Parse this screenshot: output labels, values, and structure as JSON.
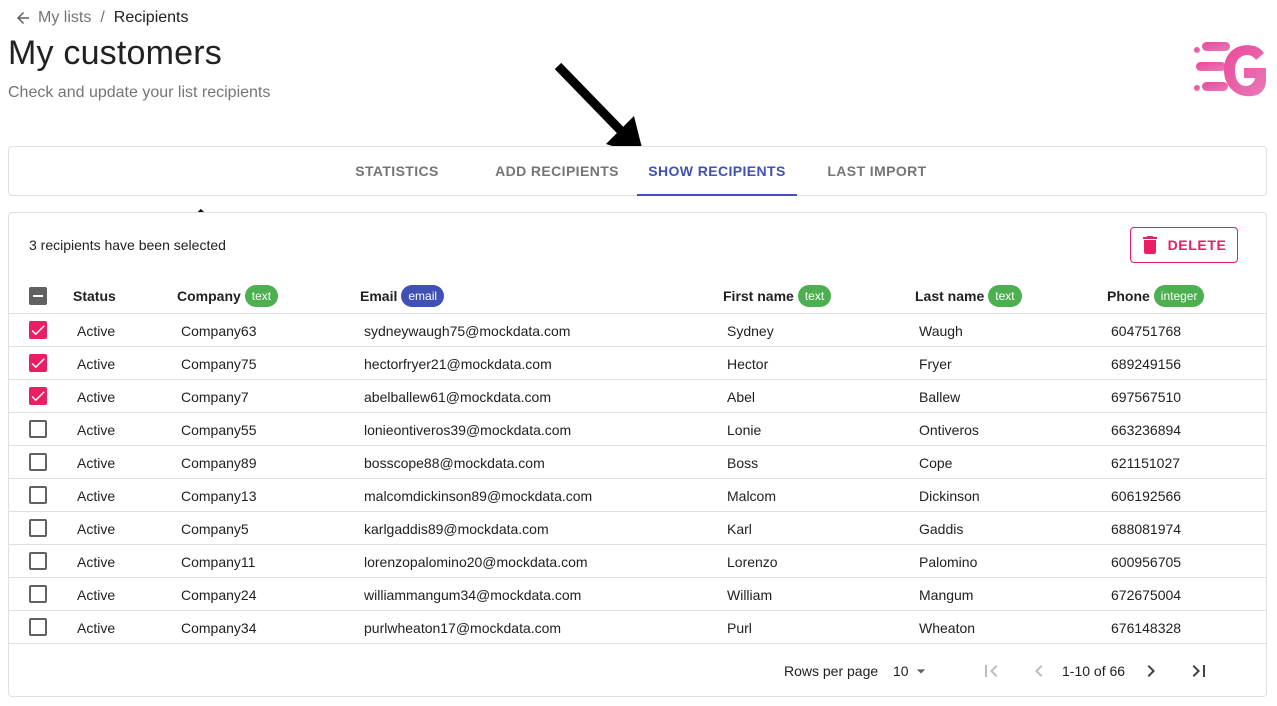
{
  "breadcrumb": {
    "parent": "My lists",
    "separator": "/",
    "current": "Recipients"
  },
  "header": {
    "title": "My customers",
    "subtitle": "Check and update your list recipients"
  },
  "colors": {
    "accent": "#3f51b5",
    "danger": "#e91e63",
    "text_badge": "#4caf50",
    "email_badge": "#3f51b5",
    "logo_gradient": [
      "#ec4899",
      "#e879b9"
    ]
  },
  "tabs": [
    {
      "label": "STATISTICS",
      "active": false
    },
    {
      "label": "ADD RECIPIENTS",
      "active": false
    },
    {
      "label": "SHOW RECIPIENTS",
      "active": true
    },
    {
      "label": "LAST IMPORT",
      "active": false
    }
  ],
  "selection": {
    "message": "3 recipients have been selected",
    "delete_label": "DELETE",
    "delete_icon": "trash-icon"
  },
  "columns": [
    {
      "label": "Status",
      "type": ""
    },
    {
      "label": "Company",
      "type": "text"
    },
    {
      "label": "Email",
      "type": "email"
    },
    {
      "label": "First name",
      "type": "text"
    },
    {
      "label": "Last name",
      "type": "text"
    },
    {
      "label": "Phone",
      "type": "integer"
    }
  ],
  "rows": [
    {
      "checked": true,
      "status": "Active",
      "company": "Company63",
      "email": "sydneywaugh75@mockdata.com",
      "first": "Sydney",
      "last": "Waugh",
      "phone": "604751768"
    },
    {
      "checked": true,
      "status": "Active",
      "company": "Company75",
      "email": "hectorfryer21@mockdata.com",
      "first": "Hector",
      "last": "Fryer",
      "phone": "689249156"
    },
    {
      "checked": true,
      "status": "Active",
      "company": "Company7",
      "email": "abelballew61@mockdata.com",
      "first": "Abel",
      "last": "Ballew",
      "phone": "697567510"
    },
    {
      "checked": false,
      "status": "Active",
      "company": "Company55",
      "email": "lonieontiveros39@mockdata.com",
      "first": "Lonie",
      "last": "Ontiveros",
      "phone": "663236894"
    },
    {
      "checked": false,
      "status": "Active",
      "company": "Company89",
      "email": "bosscope88@mockdata.com",
      "first": "Boss",
      "last": "Cope",
      "phone": "621151027"
    },
    {
      "checked": false,
      "status": "Active",
      "company": "Company13",
      "email": "malcomdickinson89@mockdata.com",
      "first": "Malcom",
      "last": "Dickinson",
      "phone": "606192566"
    },
    {
      "checked": false,
      "status": "Active",
      "company": "Company5",
      "email": "karlgaddis89@mockdata.com",
      "first": "Karl",
      "last": "Gaddis",
      "phone": "688081974"
    },
    {
      "checked": false,
      "status": "Active",
      "company": "Company11",
      "email": "lorenzopalomino20@mockdata.com",
      "first": "Lorenzo",
      "last": "Palomino",
      "phone": "600956705"
    },
    {
      "checked": false,
      "status": "Active",
      "company": "Company24",
      "email": "williammangum34@mockdata.com",
      "first": "William",
      "last": "Mangum",
      "phone": "672675004"
    },
    {
      "checked": false,
      "status": "Active",
      "company": "Company34",
      "email": "purlwheaton17@mockdata.com",
      "first": "Purl",
      "last": "Wheaton",
      "phone": "676148328"
    }
  ],
  "pagination": {
    "rows_per_page_label": "Rows per page",
    "rows_per_page": "10",
    "range": "1-10 of 66"
  }
}
